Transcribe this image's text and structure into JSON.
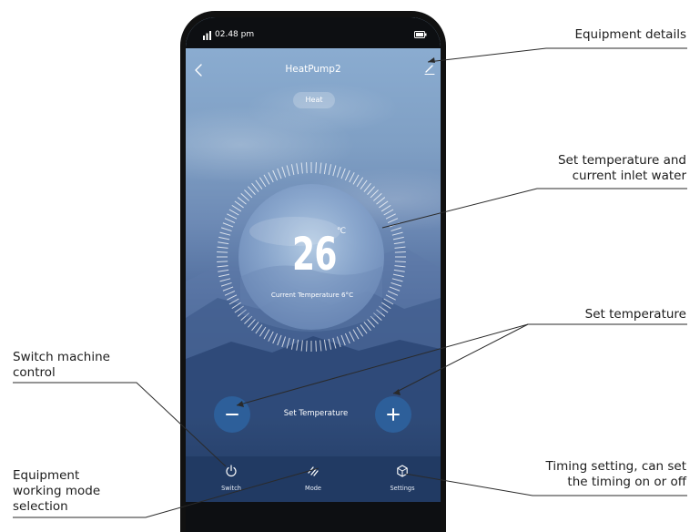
{
  "status_bar": {
    "time": "02.48 pm",
    "icons": [
      "signal-icon",
      "battery-icon"
    ]
  },
  "header": {
    "title": "HeatPump2",
    "back_icon": "chevron-left-icon",
    "edit_icon": "pencil-icon"
  },
  "mode_badge": "Heat",
  "dial": {
    "set_value": "26",
    "unit": "℃",
    "current_temperature": "Current Temperature 6°C"
  },
  "set_temperature": {
    "label": "Set Temperature",
    "decrease_icon": "minus-icon",
    "increase_icon": "plus-icon"
  },
  "bottom_nav": [
    {
      "label": "Switch",
      "icon": "power-icon"
    },
    {
      "label": "Mode",
      "icon": "mode-slashes-icon"
    },
    {
      "label": "Settings",
      "icon": "settings-hexagon-icon"
    }
  ],
  "annotations": {
    "equipment_details": "Equipment details",
    "set_temp_inlet": "Set temperature and\ncurrent inlet water",
    "set_temperature": "Set temperature",
    "switch_control": "Switch machine\ncontrol",
    "working_mode": "Equipment\nworking mode\nselection",
    "timing": "Timing setting, can set\nthe timing on or off"
  },
  "colors": {
    "accent_button": "#2d5f9a",
    "bottom_bar": "#213a63",
    "sky_top": "#8eb0d4",
    "sky_bottom": "#23395f"
  }
}
